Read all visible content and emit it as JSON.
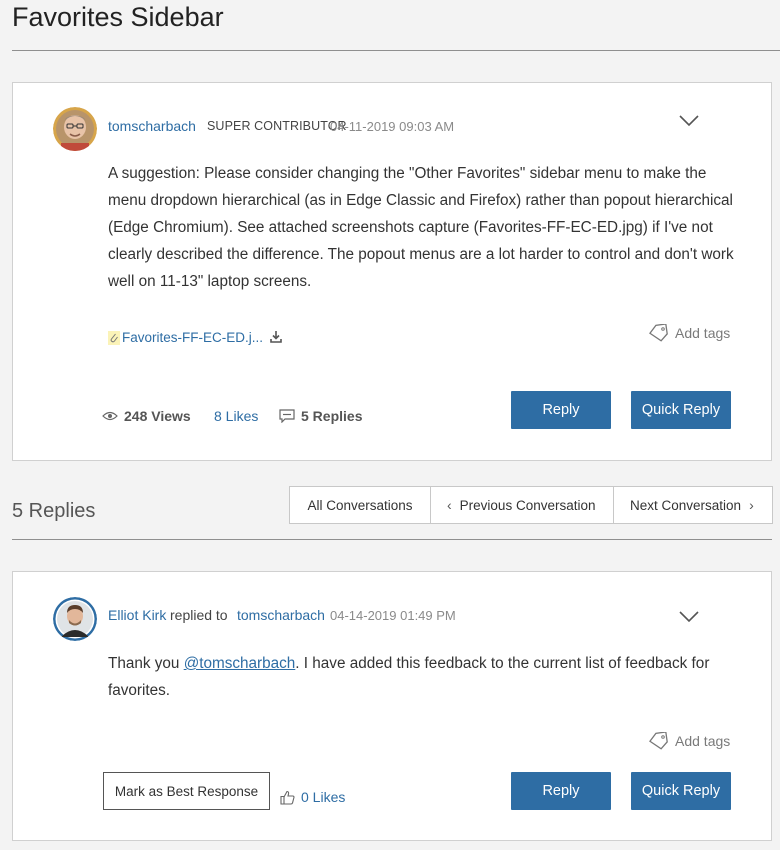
{
  "page": {
    "title": "Favorites Sidebar"
  },
  "post": {
    "author": "tomscharbach",
    "rank": "SUPER CONTRIBUTOR",
    "date": "04-11-2019 09:03 AM",
    "body": "A suggestion:  Please consider changing the \"Other Favorites\" sidebar menu to make the menu dropdown hierarchical (as in Edge Classic and Firefox) rather than popout hierarchical (Edge Chromium).  See attached screenshots capture (Favorites-FF-EC-ED.jpg) if I've not clearly described the difference.  The popout menus are a lot harder to control and don't work well on 11-13\" laptop screens.",
    "attachment": "Favorites-FF-EC-ED.j...",
    "add_tags": "Add tags",
    "views": "248 Views",
    "likes": "8 Likes",
    "replies": "5 Replies",
    "reply_label": "Reply",
    "quick_reply_label": "Quick Reply"
  },
  "replies_section": {
    "heading": "5 Replies",
    "nav": {
      "all": "All Conversations",
      "previous": "Previous Conversation",
      "next": "Next Conversation"
    }
  },
  "reply": {
    "author": "Elliot Kirk",
    "replied_to_label": "replied to",
    "replied_to": "tomscharbach",
    "date": "04-14-2019 01:49 PM",
    "body_prefix": "Thank you ",
    "mention": "@tomscharbach",
    "body_suffix": ". I have added this feedback to the current list of feedback for favorites.",
    "add_tags": "Add tags",
    "best_response_label": "Mark as Best Response",
    "likes": "0 Likes",
    "reply_label": "Reply",
    "quick_reply_label": "Quick Reply"
  },
  "icons": {
    "chevron": "chevron-down-icon",
    "attachment": "paperclip-icon",
    "download": "download-icon",
    "tag": "tag-icon",
    "views": "eye-icon",
    "replies": "speech-bubble-icon",
    "thumbs_up": "thumbs-up-icon"
  },
  "colors": {
    "accent": "#2e6da4",
    "background": "#f3f3f3"
  }
}
